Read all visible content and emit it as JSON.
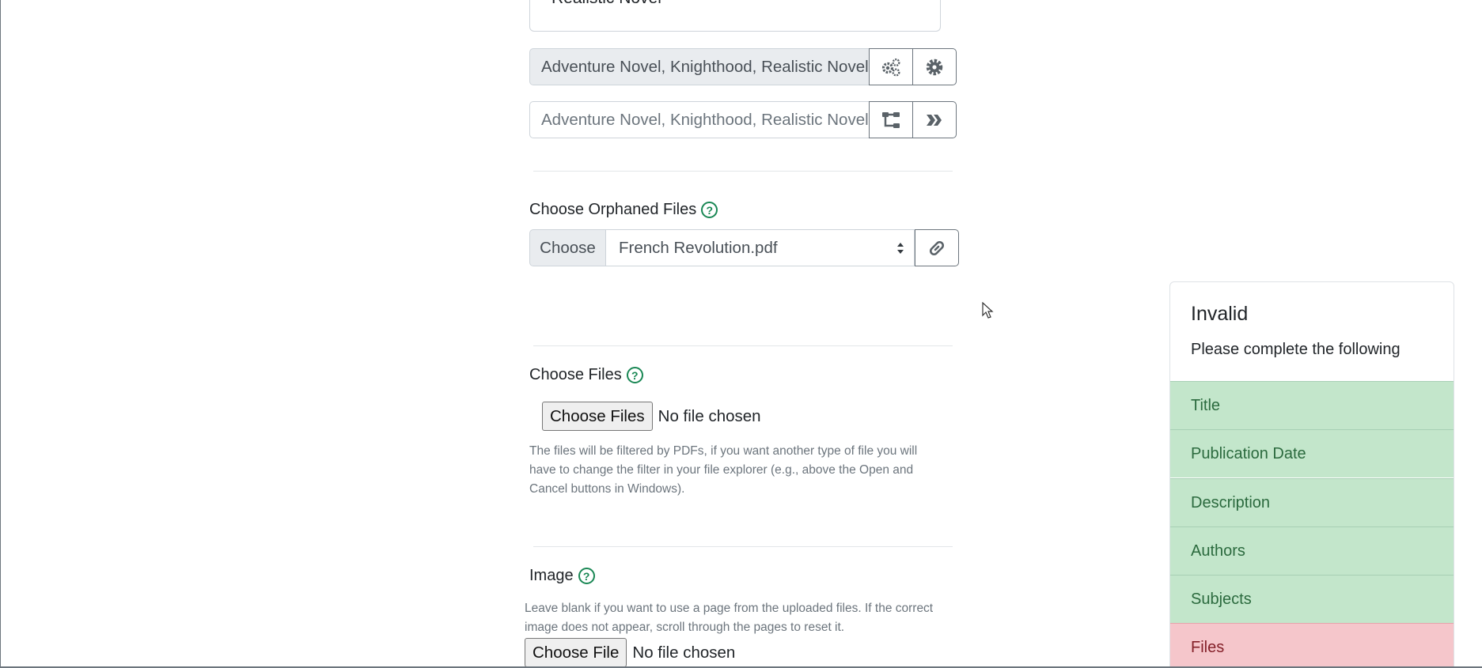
{
  "subjects_tag": {
    "label": "Realistic Novel",
    "remove": "×"
  },
  "subjects_selected": {
    "value": "Adventure Novel, Knighthood, Realistic Novel"
  },
  "subjects_search": {
    "placeholder": "Adventure Novel, Knighthood, Realistic Novel"
  },
  "orphaned": {
    "label": "Choose Orphaned Files",
    "help": "?",
    "prefix": "Choose",
    "selected": "French Revolution.pdf"
  },
  "files": {
    "label": "Choose Files",
    "help": "?",
    "button": "Choose Files",
    "status": "No file chosen",
    "hint": "The files will be filtered by PDFs, if you want another type of file you will have to change the filter in your file explorer (e.g., above the Open and Cancel buttons in Windows)."
  },
  "image": {
    "label": "Image",
    "help": "?",
    "hint": "Leave blank if you want to use a page from the uploaded files. If the correct image does not appear, scroll through the pages to reset it.",
    "button": "Choose File",
    "status": "No file chosen"
  },
  "validation": {
    "title": "Invalid",
    "subtitle": "Please complete the following",
    "items": [
      {
        "label": "Title",
        "status": "ok"
      },
      {
        "label": "Publication Date",
        "status": "ok"
      },
      {
        "label": "Description",
        "status": "ok"
      },
      {
        "label": "Authors",
        "status": "ok"
      },
      {
        "label": "Subjects",
        "status": "ok"
      },
      {
        "label": "Files",
        "status": "invalid"
      }
    ]
  },
  "icons": {
    "gears": "gears-icon",
    "gear": "gear-icon",
    "tree": "sitemap-icon",
    "hive": "hive-icon",
    "link": "link-icon",
    "help": "question-circle-icon"
  },
  "colors": {
    "ok_bg": "#c3e6cb",
    "invalid_bg": "#f5c6cb",
    "help_green": "#198754"
  }
}
